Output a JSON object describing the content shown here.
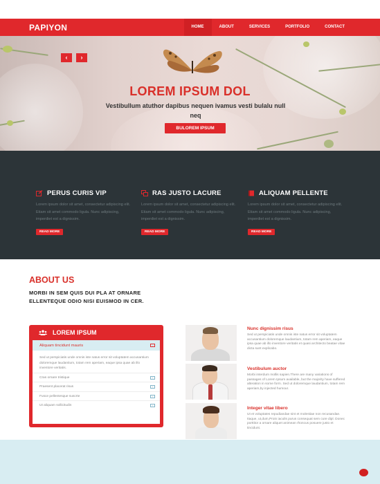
{
  "nav": {
    "logo": "PAPIYON",
    "items": [
      {
        "label": "HOME",
        "active": true
      },
      {
        "label": "ABOUT",
        "active": false
      },
      {
        "label": "SERVICES",
        "active": false
      },
      {
        "label": "PORTFOLIO",
        "active": false
      },
      {
        "label": "CONTACT",
        "active": false
      }
    ]
  },
  "hero": {
    "prev_icon": "chevron-left-icon",
    "next_icon": "chevron-right-icon",
    "title": "LOREM IPSUM DOL",
    "subtitle": "Vestibullum atuthor dapibus nequen ivamus vesti bulalu null neq",
    "button": "BULOREM IPSUM"
  },
  "features": [
    {
      "icon": "edit-icon",
      "title": "PERUS CURIS VIP",
      "body": "Lorem ipsum dolor sit amet, consectetur adipiscing elit. Etiam sit amet commodo ligula. Nunc adipiscing, imperdiet est a dignissim.",
      "button": "READ MORE"
    },
    {
      "icon": "copy-icon",
      "title": "RAS JUSTO LACURE",
      "body": "Lorem ipsum dolor sit amet, consectetur adipiscing elit. Etiam sit amet commodo ligula. Nunc adipiscing, imperdiet est a dignissim.",
      "button": "READ MORE"
    },
    {
      "icon": "book-icon",
      "title": "ALIQUAM PELLENTE",
      "body": "Lorem ipsum dolor sit amet, consectetur adipiscing elit. Etiam sit amet commodo ligula. Nunc adipiscing, imperdiet est a dignissim.",
      "button": "READ MORE"
    }
  ],
  "about": {
    "title": "ABOUT US",
    "text": "MORBI IN SEM QUIS DUI PLA AT ORNARE ELLENTEQUE ODIO NISI EUISMOD IN CER."
  },
  "panel": {
    "icon": "users-icon",
    "title": "LOREM IPSUM",
    "open_item": {
      "label": "Aliquam tincidunt mauris",
      "body": "Sed ut perspiciatis unde omnis iste natus error sit voluptatem accusantium doloremque laudantium, totam rem aperiam, eaque ipsa quae ab illo inventore veritatis."
    },
    "items": [
      "Cras ornare tristique",
      "Praesent placerat risus",
      "Fusce pellentesque suscrte",
      "Ut aliquam sollicitudin"
    ]
  },
  "testimonials": [
    {
      "title": "Nunc dignissim risus",
      "text": "Sed ut perspiciatis unde omnis iste natus error sit voluptatem accusantium doloremque laudantium, totam rem aperiam, eaque ipsa quae ab illo inventore veritatis et quasi architecto beatae vitae dicta sunt explicabo."
    },
    {
      "title": "Vestibulum auctor",
      "text": "Morbi interdum mollis sapien.There are many variations of passages of Lorem Ipsum available, but the majority have suffered alteration in some form. Sed ut doloremque laudantium, totam rem aperiam,by injected humour."
    },
    {
      "title": "Integer vitae libero",
      "text": "Ut et voluptates repudiandae sint et molestiae non recusandae. Itaque, ut,dum,Proin iaculis purus consequat sem cure dipl. Donec porttitor a ornare aliquet animean rhoncus posuere justo et tincidunt."
    }
  ],
  "colors": {
    "accent": "#e0282c",
    "dark": "#2c3438",
    "light_band": "#d8edf2"
  }
}
